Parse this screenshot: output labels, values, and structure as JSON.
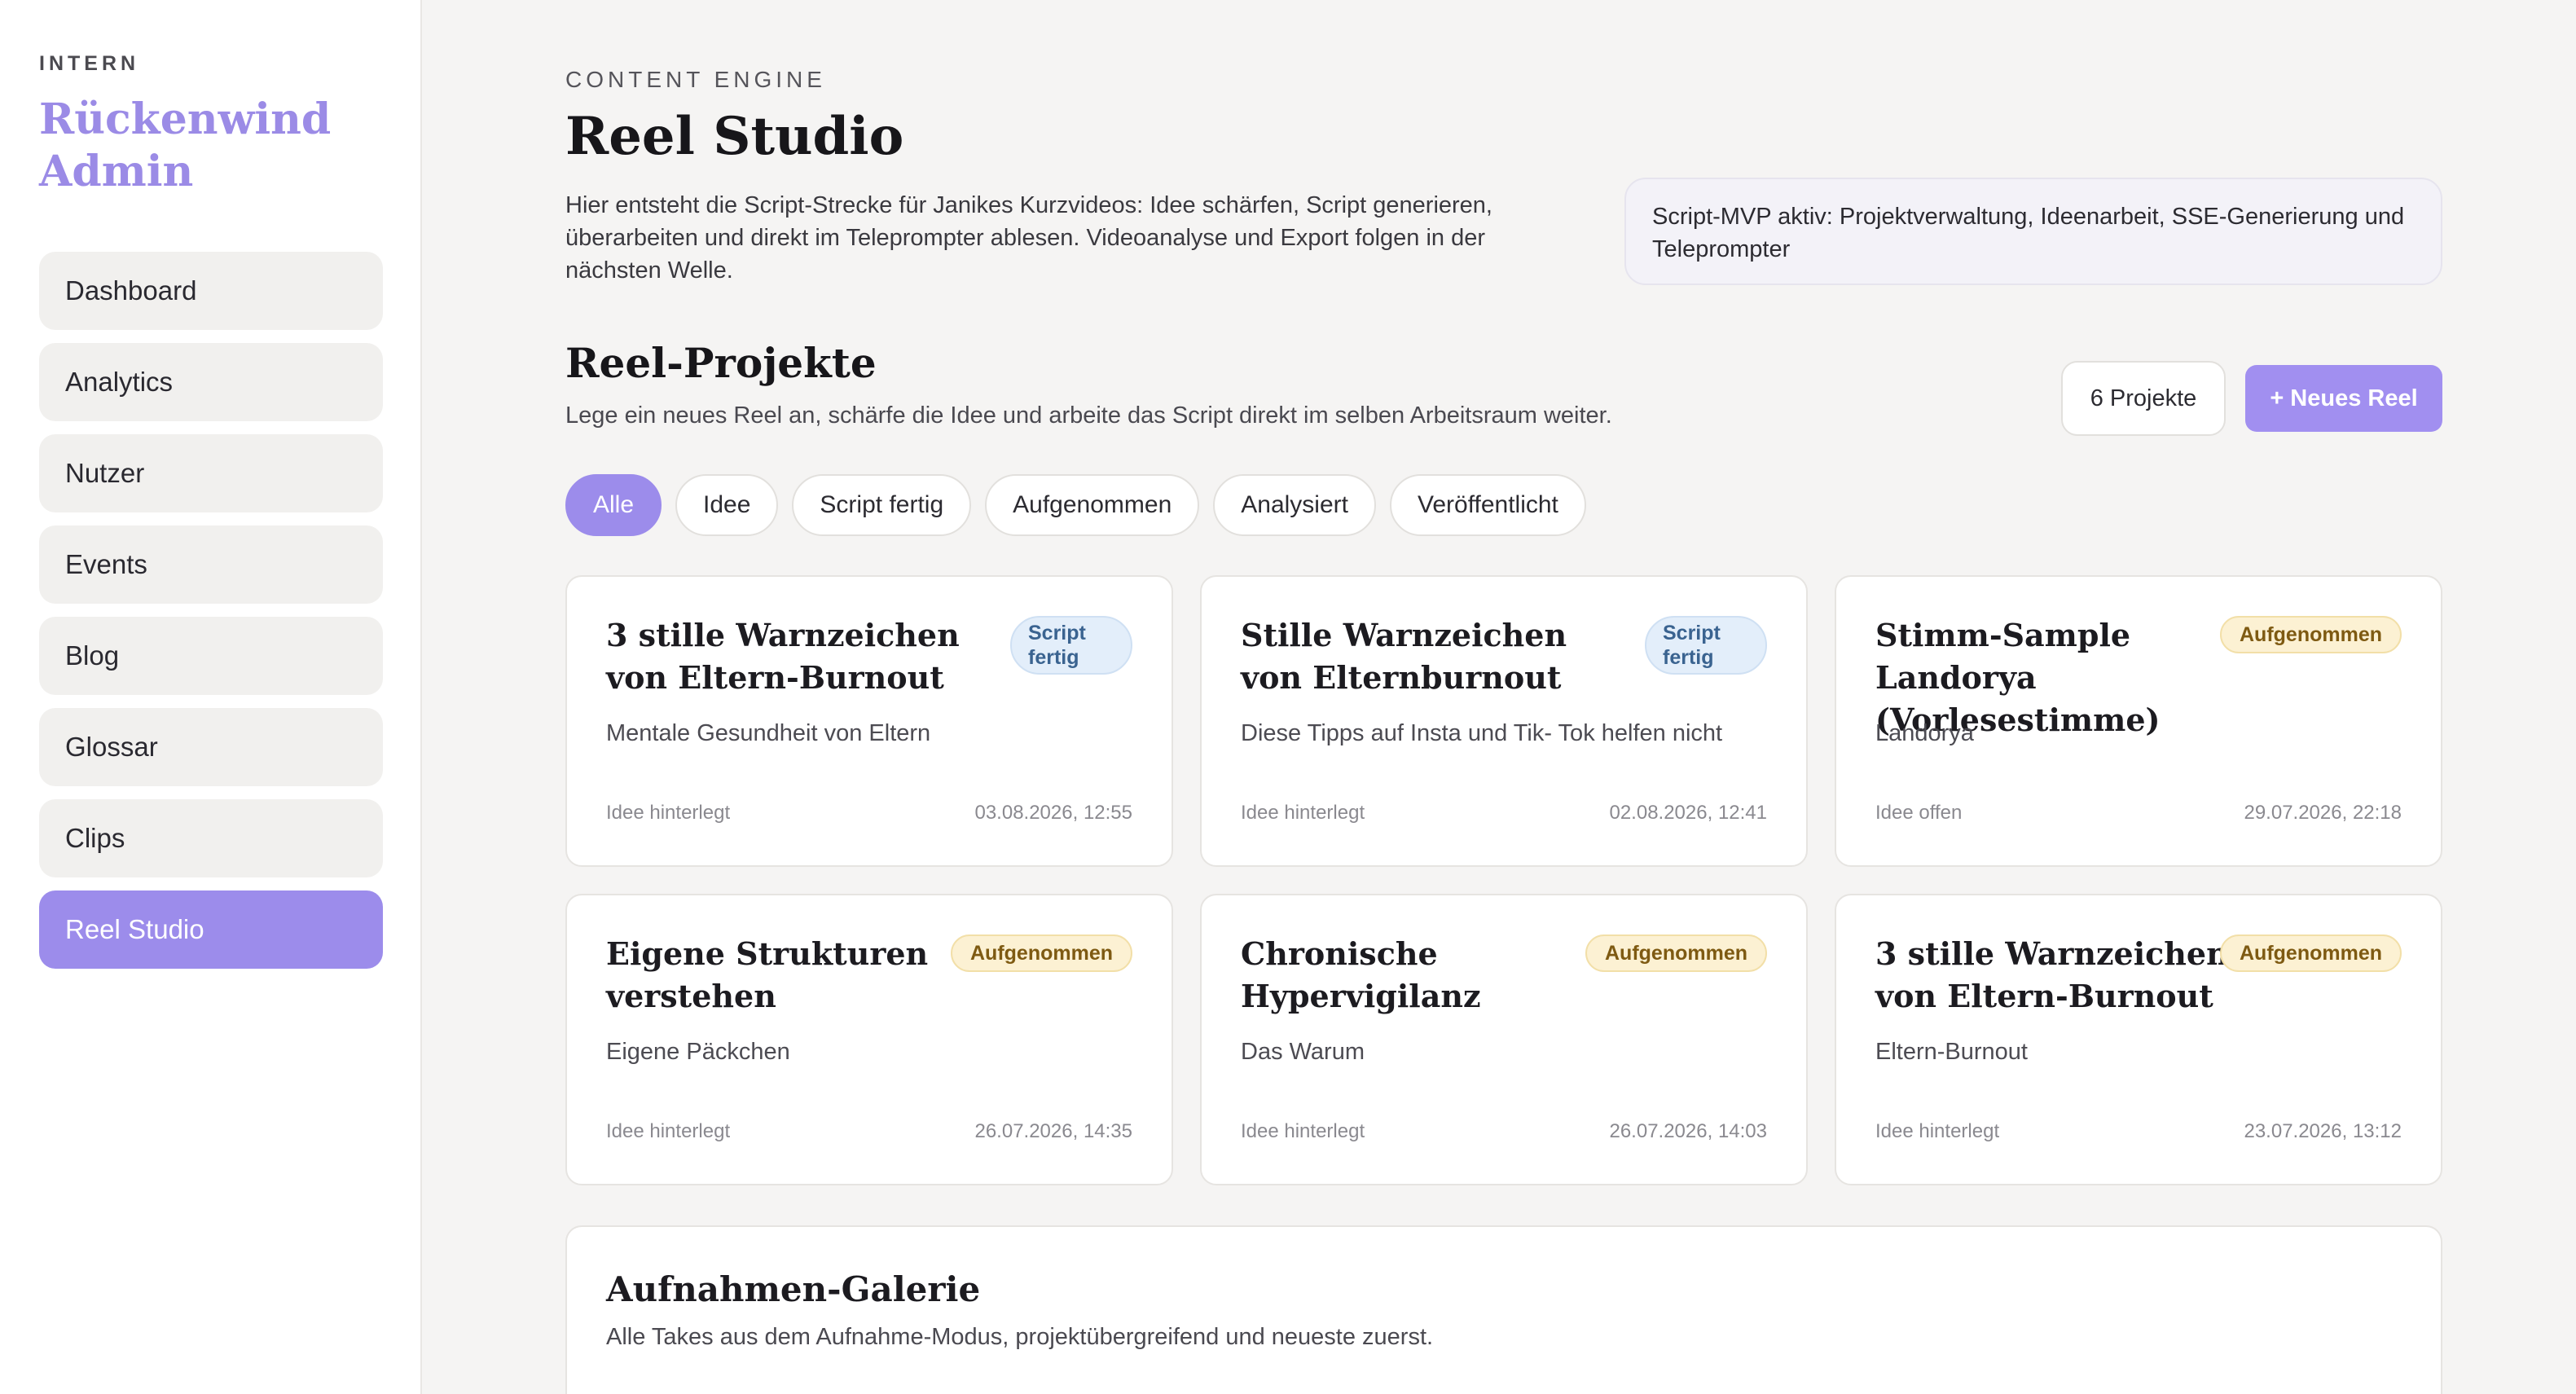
{
  "sidebar": {
    "eyebrow": "INTERN",
    "brand": "Rückenwind Admin",
    "items": [
      {
        "label": "Dashboard",
        "active": false
      },
      {
        "label": "Analytics",
        "active": false
      },
      {
        "label": "Nutzer",
        "active": false
      },
      {
        "label": "Events",
        "active": false
      },
      {
        "label": "Blog",
        "active": false
      },
      {
        "label": "Glossar",
        "active": false
      },
      {
        "label": "Clips",
        "active": false
      },
      {
        "label": "Reel Studio",
        "active": true
      }
    ]
  },
  "header": {
    "eyebrow": "CONTENT ENGINE",
    "title": "Reel Studio",
    "description": "Hier entsteht die Script-Strecke für Janikes Kurzvideos: Idee schärfen, Script generieren, überarbeiten und direkt im Teleprompter ablesen. Videoanalyse und Export folgen in der nächsten Welle.",
    "info": "Script-MVP aktiv: Projektverwaltung, Ideenarbeit, SSE-Generierung und Teleprompter"
  },
  "projects": {
    "title": "Reel-Projekte",
    "description": "Lege ein neues Reel an, schärfe die Idee und arbeite das Script direkt im selben Arbeitsraum weiter.",
    "count_label": "6 Projekte",
    "new_button": "+ Neues Reel",
    "filters": [
      {
        "label": "Alle",
        "active": true
      },
      {
        "label": "Idee",
        "active": false
      },
      {
        "label": "Script fertig",
        "active": false
      },
      {
        "label": "Aufgenommen",
        "active": false
      },
      {
        "label": "Analysiert",
        "active": false
      },
      {
        "label": "Veröffentlicht",
        "active": false
      }
    ],
    "cards": [
      {
        "title": "3 stille Warnzeichen von Eltern-Burnout",
        "status": "Script fertig",
        "status_type": "script",
        "subtitle": "Mentale Gesundheit von Eltern",
        "idea_state": "Idee hinterlegt",
        "date": "03.08.2026, 12:55"
      },
      {
        "title": "Stille Warnzeichen von Elternburnout",
        "status": "Script fertig",
        "status_type": "script",
        "subtitle": "Diese Tipps auf Insta und Tik- Tok helfen nicht",
        "idea_state": "Idee hinterlegt",
        "date": "02.08.2026, 12:41"
      },
      {
        "title": "Stimm-Sample Landorya (Vorlesestimme)",
        "status": "Aufgenommen",
        "status_type": "aufg",
        "subtitle": "Landorya",
        "idea_state": "Idee offen",
        "date": "29.07.2026, 22:18"
      },
      {
        "title": "Eigene Strukturen verstehen",
        "status": "Aufgenommen",
        "status_type": "aufg",
        "subtitle": "Eigene Päckchen",
        "idea_state": "Idee hinterlegt",
        "date": "26.07.2026, 14:35"
      },
      {
        "title": "Chronische Hypervigilanz",
        "status": "Aufgenommen",
        "status_type": "aufg",
        "subtitle": "Das Warum",
        "idea_state": "Idee hinterlegt",
        "date": "26.07.2026, 14:03"
      },
      {
        "title": "3 stille Warnzeichen von Eltern-Burnout",
        "status": "Aufgenommen",
        "status_type": "aufg",
        "subtitle": "Eltern-Burnout",
        "idea_state": "Idee hinterlegt",
        "date": "23.07.2026, 13:12"
      }
    ]
  },
  "gallery": {
    "title": "Aufnahmen-Galerie",
    "description": "Alle Takes aus dem Aufnahme-Modus, projektübergreifend und neueste zuerst."
  }
}
